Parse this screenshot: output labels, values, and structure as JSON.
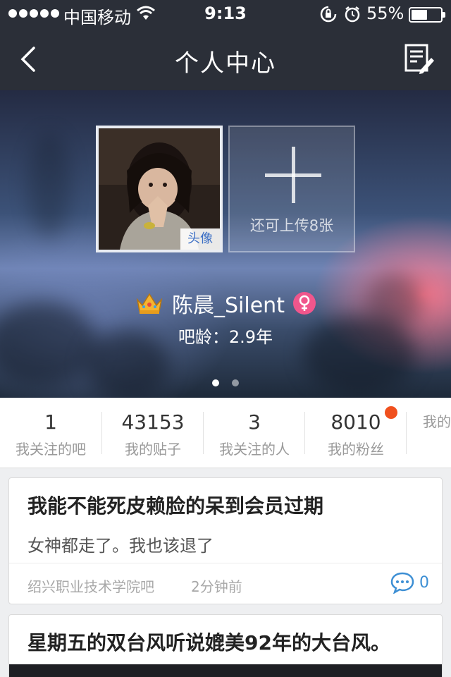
{
  "status_bar": {
    "carrier": "中国移动",
    "time": "9:13",
    "battery_percent_text": "55%",
    "battery_level": 0.55,
    "icons": [
      "signal-dots",
      "wifi-icon",
      "orientation-lock-icon",
      "alarm-icon",
      "battery-icon"
    ]
  },
  "nav": {
    "title": "个人中心",
    "left_icon": "back-chevron-icon",
    "right_icon": "edit-note-icon"
  },
  "profile": {
    "avatar_tag": "头像",
    "upload_hint": "还可上传8张",
    "username": "陈晨_Silent",
    "crown_icon": "crown-icon",
    "gender_icon": "female-icon",
    "bar_age_label": "吧龄：2.9年",
    "carousel_pages": 2,
    "carousel_active_page": 1
  },
  "stats": [
    {
      "num": "1",
      "label": "我关注的吧"
    },
    {
      "num": "43153",
      "label": "我的贴子"
    },
    {
      "num": "3",
      "label": "我关注的人"
    },
    {
      "num": "8010",
      "label": "我的粉丝",
      "has_badge": true
    },
    {
      "num": "",
      "label": "我的"
    }
  ],
  "colors": {
    "header_bg": "#2b2f38",
    "badge": "#f0501e",
    "gender_female": "#f0568c",
    "link_blue": "#3d8fd4"
  },
  "posts": [
    {
      "title": "我能不能死皮赖脸的呆到会员过期",
      "excerpt": "女神都走了。我也该退了",
      "source": "绍兴职业技术学院吧",
      "time": "2分钟前",
      "comments": "0"
    },
    {
      "title": "星期五的双台风听说媲美92年的大台风。"
    }
  ]
}
